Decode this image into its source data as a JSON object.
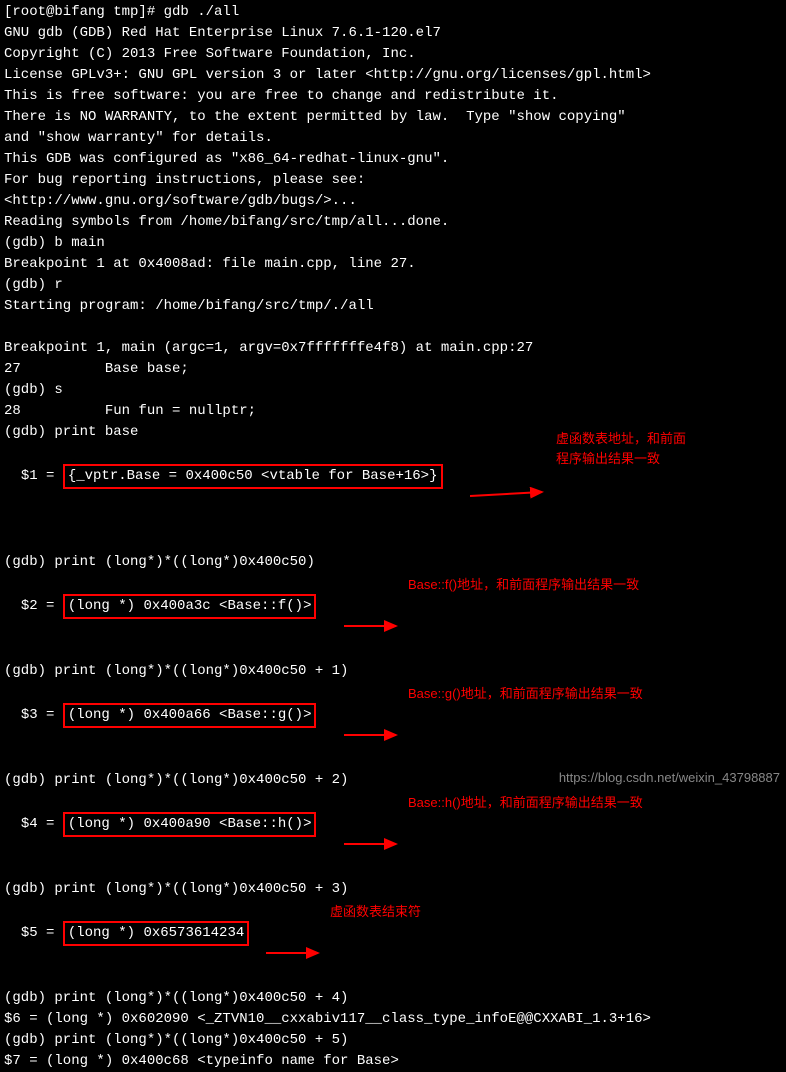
{
  "lines": {
    "l1": "[root@bifang tmp]# gdb ./all",
    "l2": "GNU gdb (GDB) Red Hat Enterprise Linux 7.6.1-120.el7",
    "l3": "Copyright (C) 2013 Free Software Foundation, Inc.",
    "l4": "License GPLv3+: GNU GPL version 3 or later <http://gnu.org/licenses/gpl.html>",
    "l5": "This is free software: you are free to change and redistribute it.",
    "l6": "There is NO WARRANTY, to the extent permitted by law.  Type \"show copying\"",
    "l7": "and \"show warranty\" for details.",
    "l8": "This GDB was configured as \"x86_64-redhat-linux-gnu\".",
    "l9": "For bug reporting instructions, please see:",
    "l10": "<http://www.gnu.org/software/gdb/bugs/>...",
    "l11": "Reading symbols from /home/bifang/src/tmp/all...done.",
    "l12": "(gdb) b main",
    "l13": "Breakpoint 1 at 0x4008ad: file main.cpp, line 27.",
    "l14": "(gdb) r",
    "l15": "Starting program: /home/bifang/src/tmp/./all",
    "l16": " ",
    "l17": "Breakpoint 1, main (argc=1, argv=0x7fffffffe4f8) at main.cpp:27",
    "l18": "27          Base base;",
    "l19": "(gdb) s",
    "l20": "28          Fun fun = nullptr;",
    "l21": "(gdb) print base",
    "l22_pre": "$1 = ",
    "l22_box": "{_vptr.Base = 0x400c50 <vtable for Base+16>}",
    "l23": "(gdb) print (long*)*((long*)0x400c50)",
    "l24_pre": "$2 = ",
    "l24_box": "(long *) 0x400a3c <Base::f()>",
    "l25": "(gdb) print (long*)*((long*)0x400c50 + 1)",
    "l26_pre": "$3 = ",
    "l26_box": "(long *) 0x400a66 <Base::g()>",
    "l27": "(gdb) print (long*)*((long*)0x400c50 + 2)",
    "l28_pre": "$4 = ",
    "l28_box": "(long *) 0x400a90 <Base::h()>",
    "l29": "(gdb) print (long*)*((long*)0x400c50 + 3)",
    "l30_pre": "$5 = ",
    "l30_box": "(long *) 0x6573614234",
    "l31": "(gdb) print (long*)*((long*)0x400c50 + 4)",
    "l32": "$6 = (long *) 0x602090 <_ZTVN10__cxxabiv117__class_type_infoE@@CXXABI_1.3+16>",
    "l33": "(gdb) print (long*)*((long*)0x400c50 + 5)",
    "l34": "$7 = (long *) 0x400c68 <typeinfo name for Base>"
  },
  "annotations": {
    "a1_line1": "虚函数表地址，和前面",
    "a1_line2": "程序输出结果一致",
    "a2": "Base::f()地址，和前面程序输出结果一致",
    "a3": "Base::g()地址，和前面程序输出结果一致",
    "a4": "Base::h()地址，和前面程序输出结果一致",
    "a5": "虚函数表结束符"
  },
  "watermark": "https://blog.csdn.net/weixin_43798887"
}
